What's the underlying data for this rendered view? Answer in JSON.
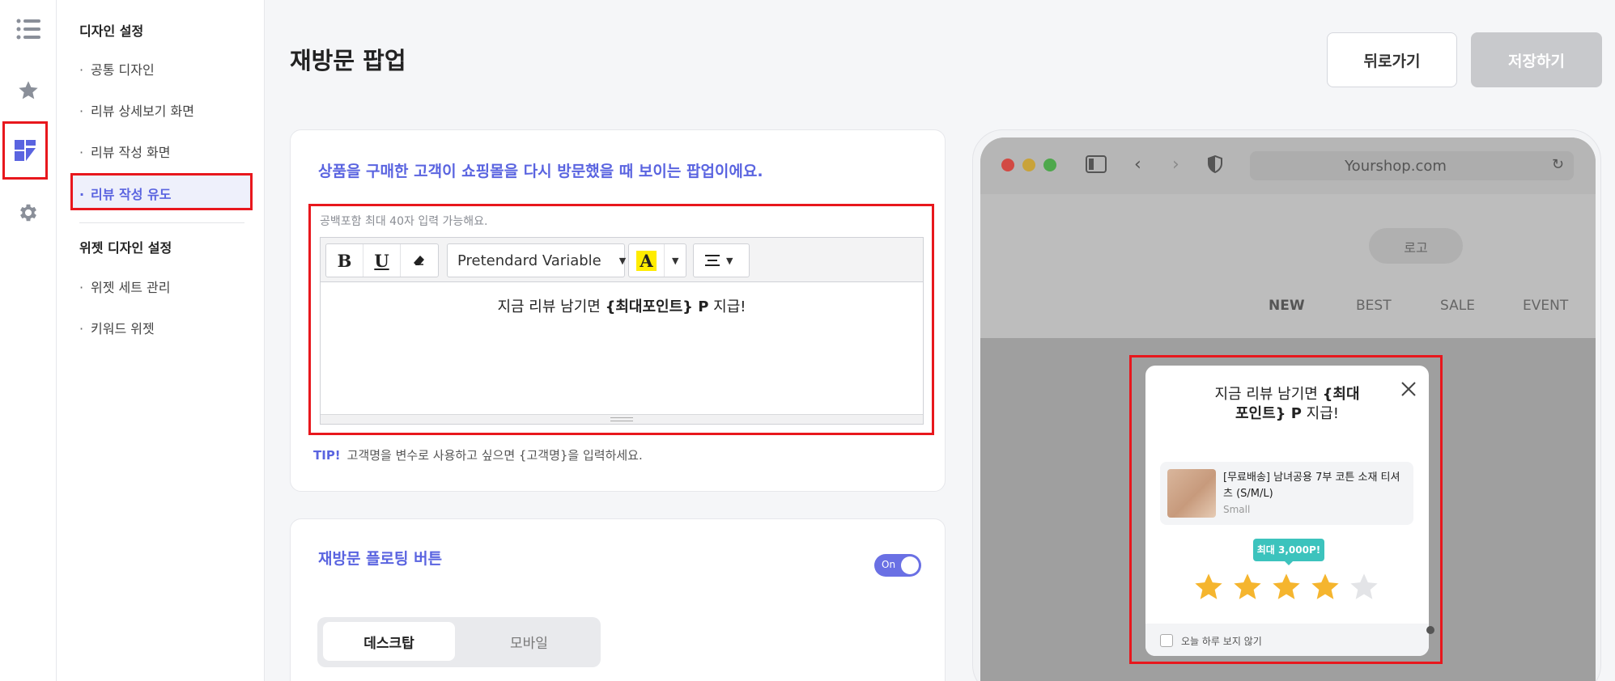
{
  "rail": {
    "items": [
      {
        "icon": "list-icon",
        "active": false
      },
      {
        "icon": "star-icon",
        "active": false
      },
      {
        "icon": "dashboard-icon",
        "active": true
      },
      {
        "icon": "gear-icon",
        "active": false
      }
    ]
  },
  "subnav": {
    "design_heading": "디자인 설정",
    "design_items": [
      "공통 디자인",
      "리뷰 상세보기 화면",
      "리뷰 작성 화면",
      "리뷰 작성 유도"
    ],
    "widget_heading": "위젯 디자인 설정",
    "widget_items": [
      "위젯 세트 관리",
      "키워드 위젯"
    ],
    "bullet": "·"
  },
  "header": {
    "title": "재방문 팝업",
    "back_label": "뒤로가기",
    "save_label": "저장하기"
  },
  "popup_card": {
    "title": "상품을 구매한 고객이 쇼핑몰을 다시 방문했을 때 보이는 팝업이에요.",
    "hint": "공백포함 최대 40자 입력 가능해요.",
    "toolbar": {
      "bold": "B",
      "underline": "U",
      "font": "Pretendard Variable",
      "color_letter": "A"
    },
    "content_prefix": "지금 리뷰 남기면 ",
    "content_bold": "{최대포인트} P",
    "content_suffix": " 지급!",
    "tip_label": "TIP!",
    "tip_text": "고객명을 변수로 사용하고 싶으면 {고객명}을 입력하세요."
  },
  "floating_card": {
    "title": "재방문 플로팅 버튼",
    "toggle_label": "On",
    "toggle_on": true,
    "tabs": [
      "데스크탑",
      "모바일"
    ],
    "active_tab": "데스크탑"
  },
  "preview": {
    "url": "Yourshop.com",
    "logo": "로고",
    "menu": [
      "NEW",
      "BEST",
      "SALE",
      "EVENT"
    ],
    "popup": {
      "msg_line1_prefix": "지금 리뷰 남기면 ",
      "msg_line1_bold": "{최대",
      "msg_line2_bold": "포인트} P",
      "msg_line2_suffix": " 지급!",
      "product_name": "[무료배송] 남녀공용 7부 코튼 소재 티셔츠 (S/M/L)",
      "product_option": "Small",
      "badge": "최대 3,000P!",
      "rating": 4,
      "rating_max": 5,
      "footer": "오늘 하루 보지 않기"
    }
  },
  "colors": {
    "accent": "#5a64e0",
    "highlight": "#e8171d",
    "star": "#f5b52e",
    "badge": "#3cc3bd"
  }
}
